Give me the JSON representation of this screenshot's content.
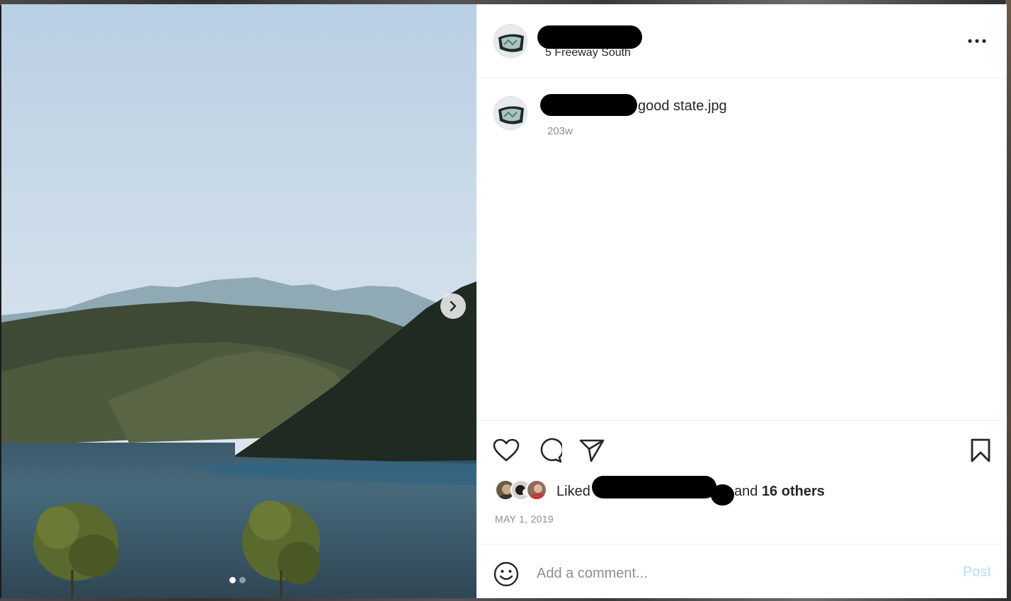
{
  "header": {
    "location": "5 Freeway South",
    "more_options_icon": "more-horizontal-icon"
  },
  "caption": {
    "text": "good state.jpg",
    "time_ago": "203w"
  },
  "photo": {
    "description_icon": "landscape-photo",
    "next_icon": "chevron-right-icon",
    "carousel": {
      "count": 2,
      "active_index": 0
    }
  },
  "actions": {
    "like_icon": "heart-icon",
    "comment_icon": "comment-icon",
    "share_icon": "send-icon",
    "save_icon": "bookmark-icon"
  },
  "likes": {
    "liked_by_label": "Liked by",
    "and_label": "and",
    "others_label": "16 others"
  },
  "date": "MAY 1, 2019",
  "comment": {
    "emoji_icon": "emoji-icon",
    "placeholder": "Add a comment...",
    "post_label": "Post"
  },
  "colors": {
    "text": "#262626",
    "muted": "#8e8e8e",
    "post_disabled": "#b2dffc",
    "divider": "#efefef"
  }
}
